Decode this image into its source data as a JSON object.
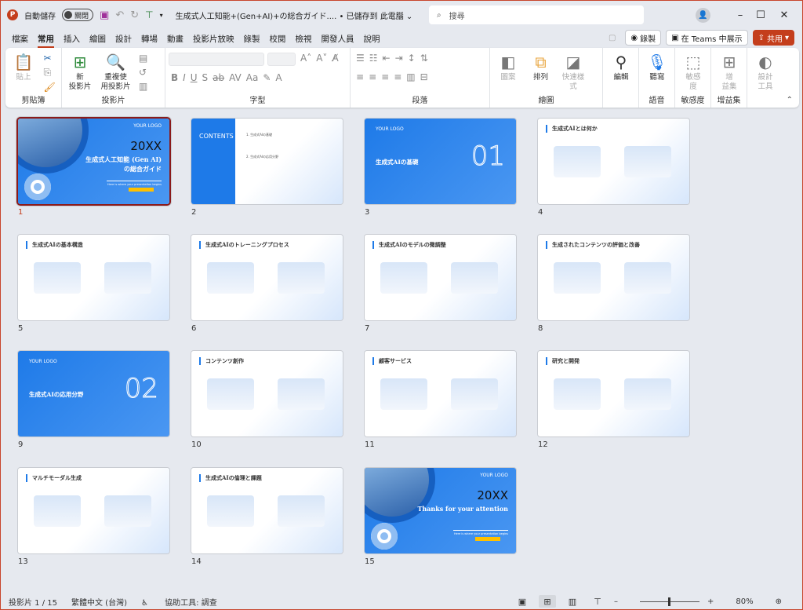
{
  "titlebar": {
    "autosave_label": "自動儲存",
    "autosave_state": "關閉",
    "doc_title": "生成式人工知能+(Gen+AI)+の総合ガイド....  • 已儲存到 此電腦 ⌄",
    "search_placeholder": "搜尋"
  },
  "tabs": [
    "檔案",
    "常用",
    "插入",
    "繪圖",
    "設計",
    "轉場",
    "動畫",
    "投影片放映",
    "錄製",
    "校閱",
    "檢視",
    "開發人員",
    "說明"
  ],
  "active_tab": 1,
  "tab_buttons": {
    "record": "錄製",
    "teams": "在 Teams 中展示",
    "share": "共用"
  },
  "ribbon": {
    "groups": {
      "clipboard": "剪貼簿",
      "slides": "投影片",
      "font": "字型",
      "paragraph": "段落",
      "drawing": "繪圖",
      "voice": "語音",
      "sensitivity": "敏感度",
      "addins": "增益集"
    },
    "paste": "貼上",
    "new_slide": "新\n投影片",
    "reuse_slides": "重複使\n用投影片",
    "shapes": "圖案",
    "arrange": "排列",
    "quick_styles": "快速樣\n式",
    "editing": "編輯",
    "dictate": "聽寫",
    "sensitivity_btn": "敏感\n度",
    "addins_btn": "增\n益集",
    "designer": "設計\n工具"
  },
  "slides": [
    {
      "num": "1",
      "type": "cover",
      "logo": "YOUR LOGO",
      "year": "20XX",
      "title": "生成式人工知能 (Gen AI)\nの総合ガイド",
      "sub": "Here is where your presentation begins"
    },
    {
      "num": "2",
      "type": "contents",
      "heading": "CONTENTS",
      "items": [
        "1.  生成式AIの基礎",
        "2.  生成式AIの応用分野"
      ]
    },
    {
      "num": "3",
      "type": "section",
      "logo": "YOUR LOGO",
      "title": "生成式AIの基礎",
      "big": "01"
    },
    {
      "num": "4",
      "type": "content",
      "title": "生成式AIとは何か"
    },
    {
      "num": "5",
      "type": "content",
      "title": "生成式AIの基本構造"
    },
    {
      "num": "6",
      "type": "content",
      "title": "生成式AIのトレーニングプロセス"
    },
    {
      "num": "7",
      "type": "content",
      "title": "生成式AIのモデルの微調整"
    },
    {
      "num": "8",
      "type": "content",
      "title": "生成されたコンテンツの評価と改善"
    },
    {
      "num": "9",
      "type": "section",
      "logo": "YOUR LOGO",
      "title": "生成式AIの応用分野",
      "big": "02"
    },
    {
      "num": "10",
      "type": "content",
      "title": "コンテンツ創作"
    },
    {
      "num": "11",
      "type": "content",
      "title": "顧客サービス"
    },
    {
      "num": "12",
      "type": "content",
      "title": "研究と開発"
    },
    {
      "num": "13",
      "type": "content",
      "title": "マルチモーダル生成"
    },
    {
      "num": "14",
      "type": "content",
      "title": "生成式AIの倫理と課題"
    },
    {
      "num": "15",
      "type": "cover",
      "logo": "YOUR LOGO",
      "year": "20XX",
      "title": "Thanks for your attention",
      "sub": "Here is where your presentation begins"
    }
  ],
  "selected_slide": 0,
  "status": {
    "slide_count": "投影片 1 / 15",
    "language": "繁體中文 (台灣)",
    "accessibility": "協助工具: 調查",
    "zoom": "80%"
  },
  "colors": {
    "accent": "#c43e1c",
    "slide_blue": "#1e7ae8",
    "slide_yellow": "#ffc000"
  }
}
